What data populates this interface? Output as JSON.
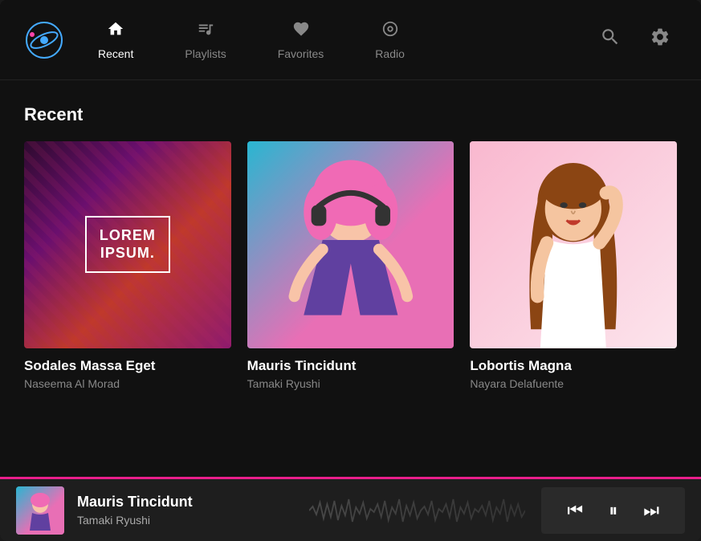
{
  "app": {
    "logo_alt": "Music App Logo"
  },
  "nav": {
    "items": [
      {
        "id": "recent",
        "label": "Recent",
        "icon": "🏠",
        "active": true
      },
      {
        "id": "playlists",
        "label": "Playlists",
        "icon": "🎵",
        "active": false
      },
      {
        "id": "favorites",
        "label": "Favorites",
        "icon": "♡",
        "active": false
      },
      {
        "id": "radio",
        "label": "Radio",
        "icon": "📻",
        "active": false
      }
    ],
    "search_icon": "🔍",
    "settings_icon": "⚙"
  },
  "main": {
    "section_title": "Recent",
    "cards": [
      {
        "id": "card1",
        "title": "Sodales Massa Eget",
        "artist": "Naseema Al Morad",
        "art_type": "abstract"
      },
      {
        "id": "card2",
        "title": "Mauris Tincidunt",
        "artist": "Tamaki Ryushi",
        "art_type": "headphones"
      },
      {
        "id": "card3",
        "title": "Lobortis Magna",
        "artist": "Nayara Delafuente",
        "art_type": "portrait"
      }
    ],
    "lorem_text_line1": "LOREM",
    "lorem_text_line2": "IPSUM."
  },
  "player": {
    "title": "Mauris Tincidunt",
    "artist": "Tamaki Ryushi",
    "controls": {
      "prev_label": "⏮",
      "play_pause_label": "⏸",
      "next_label": "⏭"
    }
  }
}
